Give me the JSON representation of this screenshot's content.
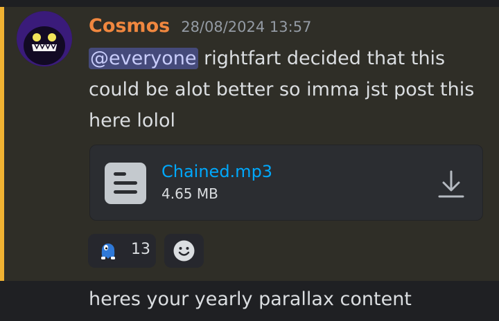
{
  "message": {
    "username": "Cosmos",
    "timestamp": "28/08/2024 13:57",
    "mention": "@everyone",
    "text": " rightfart decided that this could be alot better so imma jst post this here lolol",
    "attachment": {
      "filename": "Chained.mp3",
      "size": "4.65 MB",
      "icon": "document-icon",
      "action_icon": "download-icon"
    },
    "reactions": [
      {
        "emoji": "blue-ghost-emoji",
        "count": "13"
      }
    ],
    "add_reaction_icon": "smiley-icon"
  },
  "next_message": {
    "text": "heres your yearly parallax content"
  },
  "colors": {
    "accent_bar": "#f0b232",
    "username": "#f0873f",
    "link": "#00a8fc",
    "mention_bg": "#454a7a"
  }
}
